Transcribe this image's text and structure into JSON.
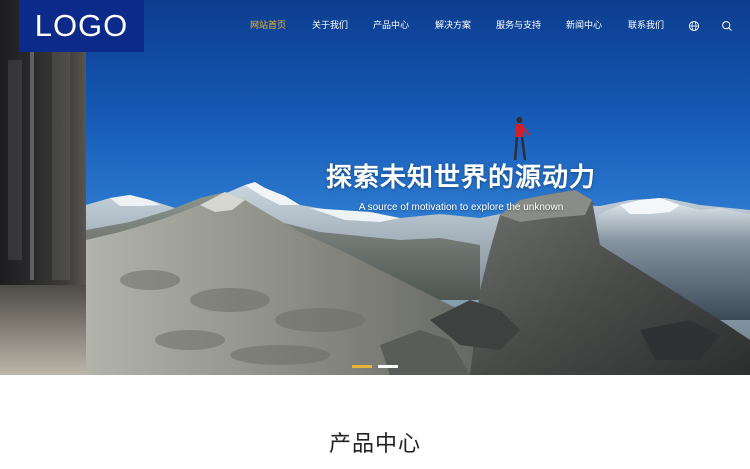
{
  "logo": {
    "text": "LOGO"
  },
  "nav": {
    "items": [
      {
        "label": "网站首页",
        "active": true
      },
      {
        "label": "关于我们",
        "active": false
      },
      {
        "label": "产品中心",
        "active": false
      },
      {
        "label": "解决方案",
        "active": false
      },
      {
        "label": "服务与支持",
        "active": false
      },
      {
        "label": "新闻中心",
        "active": false
      },
      {
        "label": "联系我们",
        "active": false
      }
    ],
    "icons": [
      "globe-icon",
      "search-icon"
    ]
  },
  "hero": {
    "title": "探索未知世界的源动力",
    "subtitle": "A source of motivation to explore the unknown",
    "slides": 2,
    "active_slide": 1
  },
  "section": {
    "title": "产品中心"
  },
  "colors": {
    "brand": "#0c2a8a",
    "active_nav": "#f2b530",
    "dot_active": "#e8b33a"
  }
}
